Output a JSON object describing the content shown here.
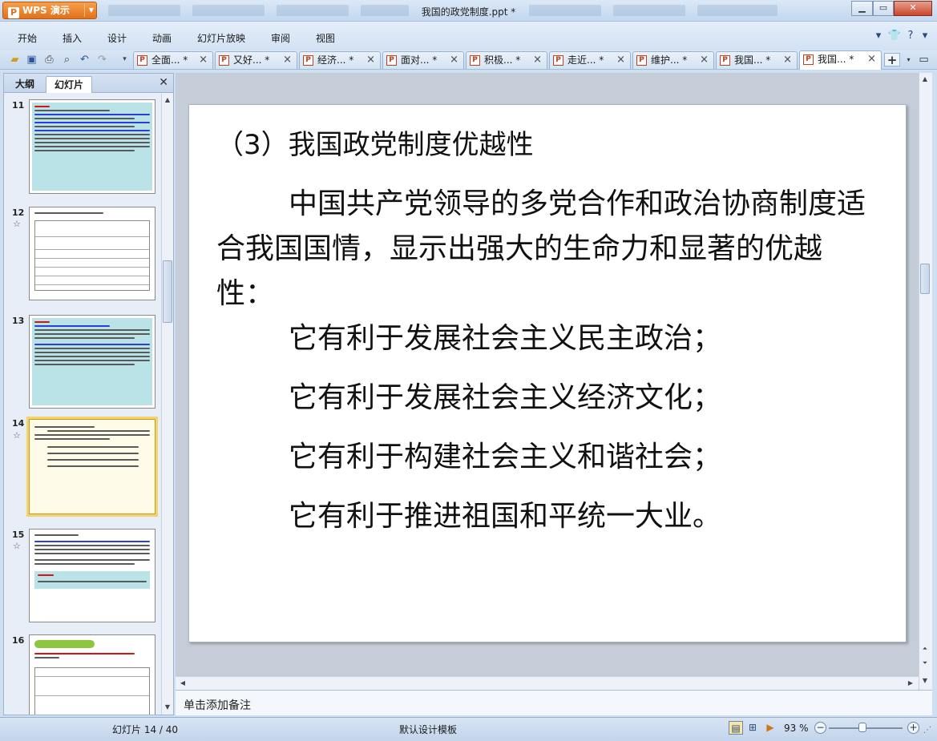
{
  "app": {
    "name": "WPS 演示",
    "window_title": "我国的政党制度.ppt *"
  },
  "menu": [
    "开始",
    "插入",
    "设计",
    "动画",
    "幻灯片放映",
    "审阅",
    "视图"
  ],
  "doc_tabs": [
    {
      "label": "全面... *"
    },
    {
      "label": "又好... *"
    },
    {
      "label": "经济... *"
    },
    {
      "label": "面对... *"
    },
    {
      "label": "积极... *"
    },
    {
      "label": "走近... *"
    },
    {
      "label": "维护... *"
    },
    {
      "label": "我国... *"
    },
    {
      "label": "我国... *",
      "active": true
    }
  ],
  "panel": {
    "tab_outline": "大纲",
    "tab_slides": "幻灯片"
  },
  "thumbnails": [
    {
      "number": "11"
    },
    {
      "number": "12"
    },
    {
      "number": "13"
    },
    {
      "number": "14"
    },
    {
      "number": "15"
    },
    {
      "number": "16"
    }
  ],
  "slide": {
    "title": "（3）我国政党制度优越性",
    "paragraph": "中国共产党领导的多党合作和政治协商制度适合我国国情，显示出强大的生命力和显著的优越性：",
    "bullets": [
      "它有利于发展社会主义民主政治；",
      "它有利于发展社会主义经济文化；",
      "它有利于构建社会主义和谐社会；",
      "它有利于推进祖国和平统一大业。"
    ]
  },
  "notes_placeholder": "单击添加备注",
  "status": {
    "slide_counter": "幻灯片 14 / 40",
    "template": "默认设计模板",
    "zoom": "93 %"
  },
  "zoom_fraction": 0.46,
  "colors": {
    "app_orange": "#e2701c",
    "selection": "#f6d36a",
    "chrome": "#cfdff2"
  }
}
